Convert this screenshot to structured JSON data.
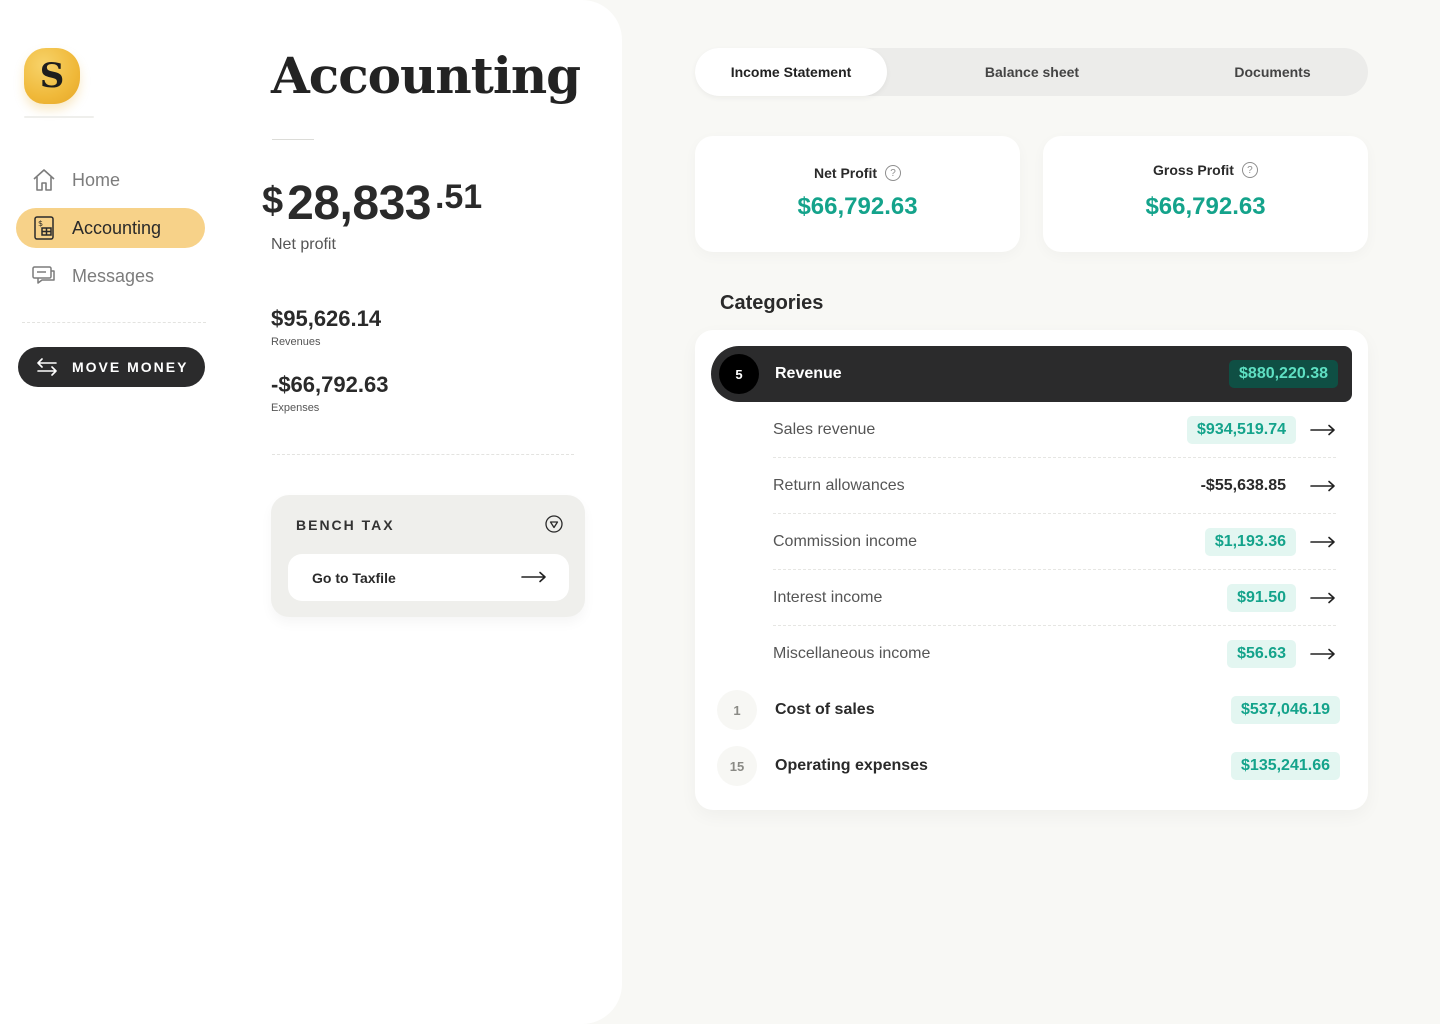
{
  "app": {
    "logo_letter": "S"
  },
  "sidebar": {
    "items": [
      {
        "label": "Home",
        "icon": "home-icon"
      },
      {
        "label": "Accounting",
        "icon": "accounting-document-icon"
      },
      {
        "label": "Messages",
        "icon": "messages-icon"
      }
    ],
    "move_money_label": "MOVE MONEY"
  },
  "summary": {
    "title": "Accounting",
    "net_profit": {
      "currency": "$",
      "integer": "28,833",
      "decimal": ".51",
      "label": "Net profit"
    },
    "revenues": {
      "value": "$95,626.14",
      "label": "Revenues"
    },
    "expenses": {
      "value": "-$66,792.63",
      "label": "Expenses"
    },
    "tax_card": {
      "title": "BENCH TAX",
      "button_label": "Go to Taxfile"
    }
  },
  "tabs": [
    {
      "label": "Income Statement",
      "active": true
    },
    {
      "label": "Balance sheet",
      "active": false
    },
    {
      "label": "Documents",
      "active": false
    }
  ],
  "kpis": {
    "net_profit": {
      "label": "Net Profit",
      "value": "$66,792.63"
    },
    "gross_profit": {
      "label": "Gross Profit",
      "value": "$66,792.63"
    }
  },
  "categories": {
    "heading": "Categories",
    "revenue": {
      "count": "5",
      "name": "Revenue",
      "amount": "$880,220.38",
      "items": [
        {
          "name": "Sales revenue",
          "amount": "$934,519.74",
          "positive": true
        },
        {
          "name": "Return allowances",
          "amount": "-$55,638.85",
          "positive": false
        },
        {
          "name": "Commission income",
          "amount": "$1,193.36",
          "positive": true
        },
        {
          "name": "Interest income",
          "amount": "$91.50",
          "positive": true
        },
        {
          "name": "Miscellaneous income",
          "amount": "$56.63",
          "positive": true
        }
      ]
    },
    "others": [
      {
        "count": "1",
        "name": "Cost of sales",
        "amount": "$537,046.19"
      },
      {
        "count": "15",
        "name": "Operating expenses",
        "amount": "$135,241.66"
      }
    ]
  },
  "colors": {
    "accent_teal": "#14a38b",
    "nav_active": "#f7d289",
    "dark": "#2b2b2c",
    "logo_gold": "#f0b93a"
  }
}
